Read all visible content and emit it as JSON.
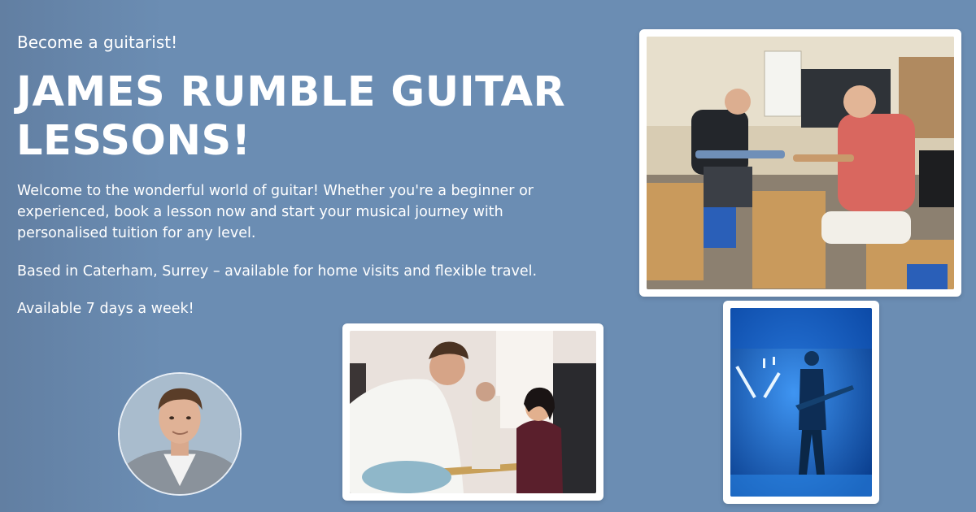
{
  "hero": {
    "kicker": "Become a guitarist!",
    "title": "JAMES RUMBLE GUITAR LESSONS!",
    "intro": "Welcome to the wonderful world of guitar! Whether you're a beginner or experienced, book a lesson now and start your musical journey with personalised tuition for any level.",
    "location": "Based in Caterham, Surrey – available for home visits and flexible travel.",
    "availability": "Available 7 days a week!"
  },
  "colors": {
    "background": "#6b8db3",
    "text": "#ffffff",
    "photo_frame": "#ffffff",
    "stage_blue": "#1f6fd6"
  },
  "images": [
    {
      "name": "avatar-photo",
      "subject": "portrait of a man in a grey sweater"
    },
    {
      "name": "classroom-lesson-photo",
      "subject": "two men playing guitars in a classroom"
    },
    {
      "name": "wedding-band-photo",
      "subject": "guitarist and singer performing"
    },
    {
      "name": "stage-blue-photo",
      "subject": "guitarist on stage in blue light"
    }
  ]
}
